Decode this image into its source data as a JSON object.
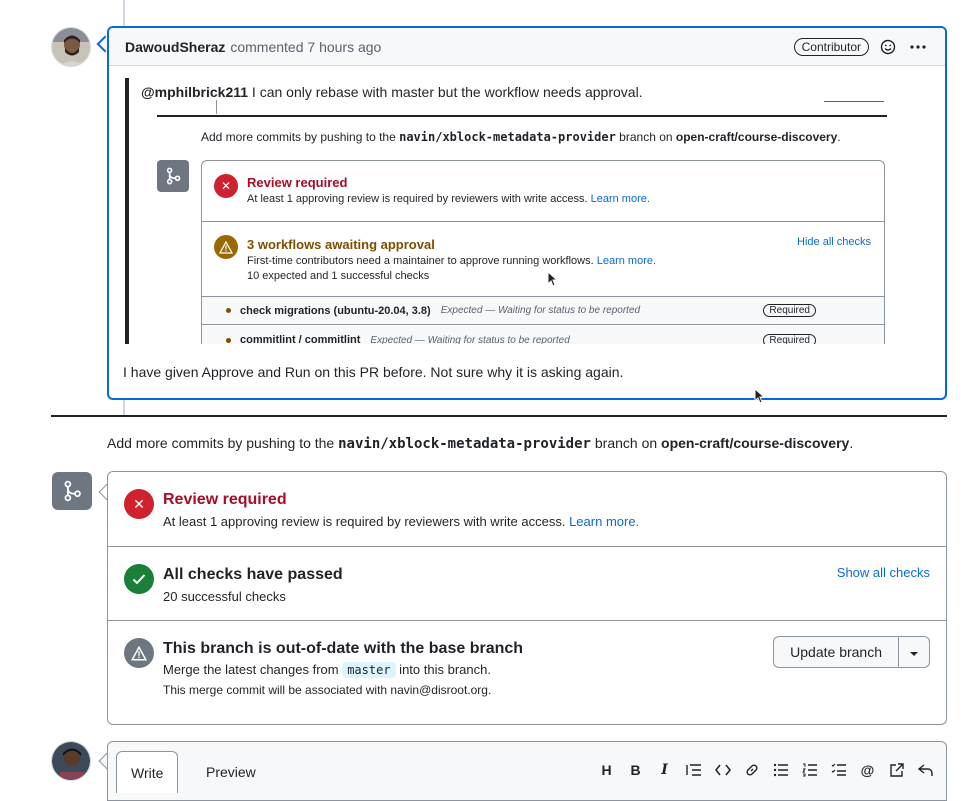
{
  "comment": {
    "author": "DawoudSheraz",
    "meta": "commented 7 hours ago",
    "role_badge": "Contributor",
    "quote": {
      "mention": "@mphilbrick211",
      "text": " I can only rebase with master but the workflow needs approval.",
      "push_prefix": "Add more commits by pushing to the ",
      "branch": "navin/xblock-metadata-provider",
      "push_mid": " branch on ",
      "repo": "open-craft/course-discovery",
      "review_title": "Review required",
      "review_desc": "At least 1 approving review is required by reviewers with write access.",
      "learn_more": "Learn more.",
      "workflows_title": "3 workflows awaiting approval",
      "workflows_desc": "First-time contributors need a maintainer to approve running workflows.",
      "workflows_counts": "10 expected and 1 successful checks",
      "hide_checks": "Hide all checks",
      "check_name": "check migrations (ubuntu-20.04, 3.8)",
      "check_status": "Expected — Waiting for status to be reported",
      "required": "Required",
      "check2_name": "commitlint / commitlint",
      "check2_status": "Expected — Waiting for status to be reported"
    },
    "body": "I have given Approve and Run on this PR before. Not sure why it is asking again."
  },
  "merge": {
    "push_prefix": "Add more commits by pushing to the ",
    "branch": "navin/xblock-metadata-provider",
    "push_mid": " branch on ",
    "repo": "open-craft/course-discovery",
    "push_suffix": ".",
    "review_title": "Review required",
    "review_desc": "At least 1 approving review is required by reviewers with write access.",
    "learn_more": "Learn more.",
    "checks_title": "All checks have passed",
    "checks_desc": "20 successful checks",
    "show_checks": "Show all checks",
    "outdated_title": "This branch is out-of-date with the base branch",
    "outdated_prefix": "Merge the latest changes from ",
    "base_branch": "master",
    "outdated_suffix": " into this branch.",
    "commit_assoc": "This merge commit will be associated with navin@disroot.org.",
    "update_button": "Update branch"
  },
  "composer": {
    "tab_write": "Write",
    "tab_preview": "Preview",
    "tools": [
      "heading-icon",
      "bold-icon",
      "italic-icon",
      "quote-icon",
      "code-icon",
      "link-icon",
      "unordered-list-icon",
      "ordered-list-icon",
      "task-list-icon",
      "mention-icon",
      "cross-reference-icon",
      "reply-icon"
    ]
  },
  "colors": {
    "accent": "#0969da",
    "danger": "#cf222e",
    "success": "#1a7f37",
    "attention": "#9a6700",
    "neutral": "#6e7781"
  }
}
